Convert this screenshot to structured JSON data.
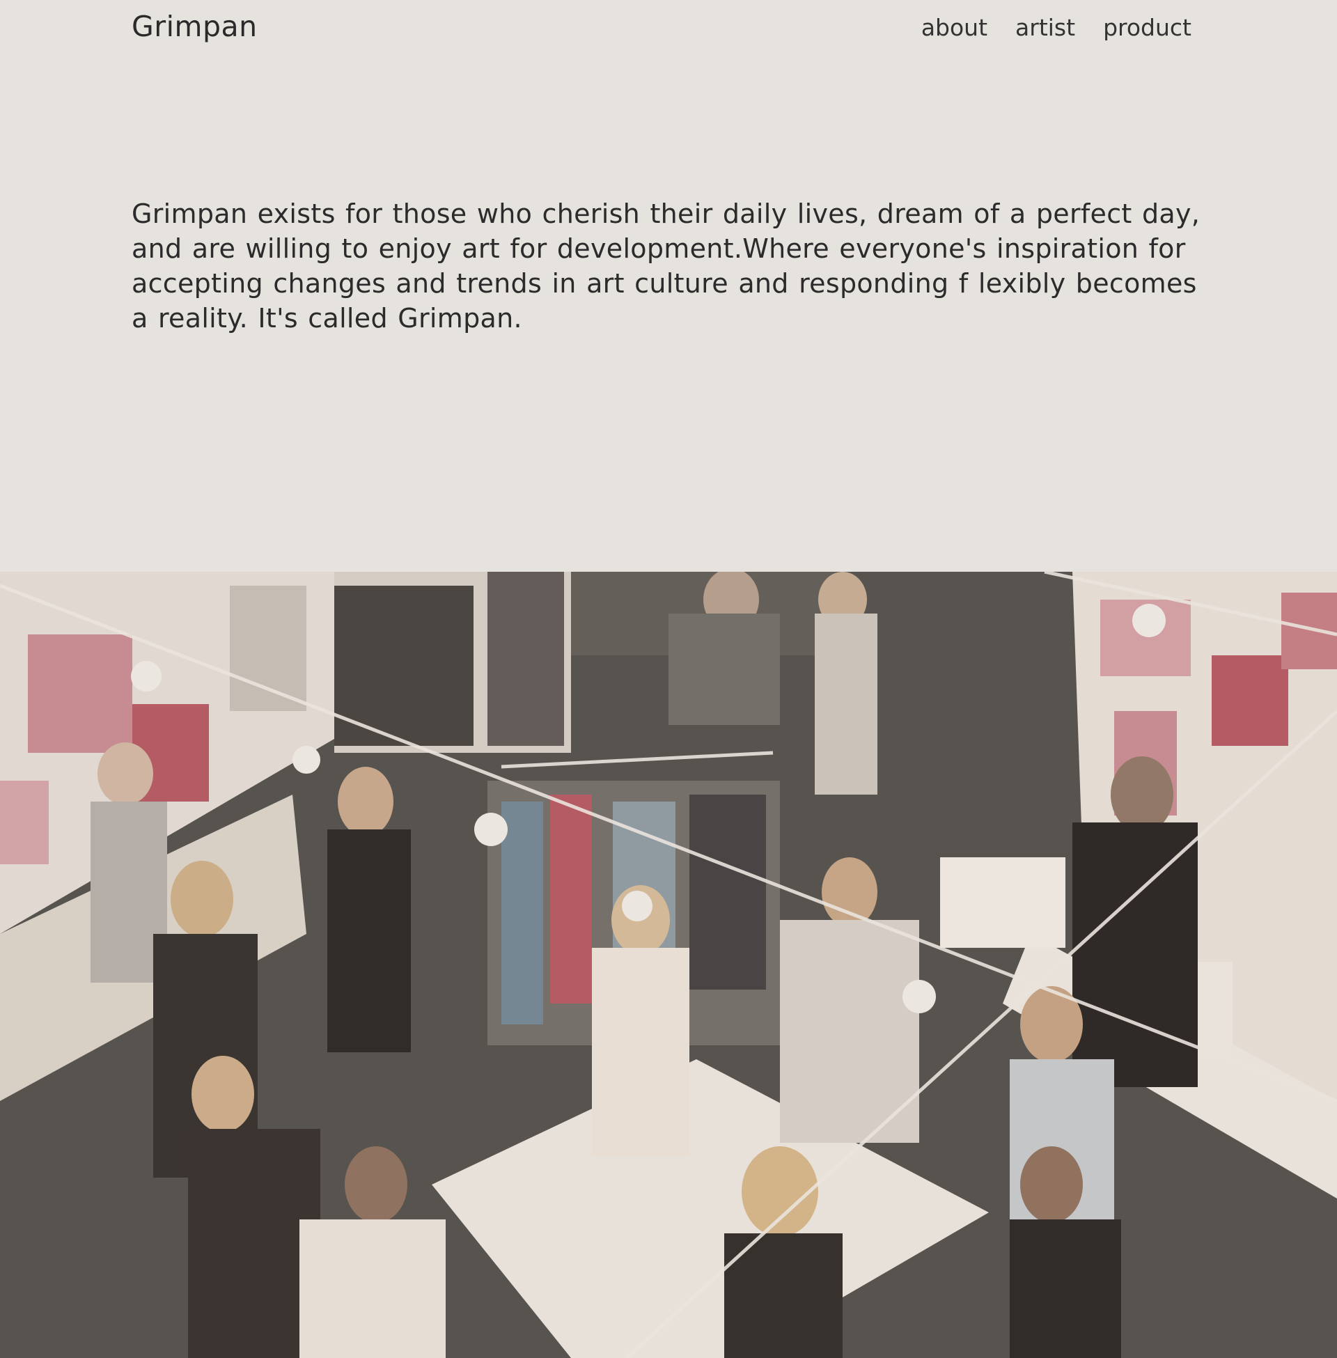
{
  "header": {
    "logo": "Grimpan",
    "nav": [
      {
        "label": "about"
      },
      {
        "label": "artist"
      },
      {
        "label": "product"
      }
    ]
  },
  "intro": {
    "text": "Grimpan exists for those who cherish their daily lives, dream of a perfect day, and are willing to enjoy art for development.Where everyone's inspiration for accepting changes and trends in art culture and responding f lexibly becomes a reality. It's called Grimpan."
  },
  "hero": {
    "image": "art-fair-crowd-photo",
    "colors": {
      "floor": "#4a4846",
      "wall": "#e9e4df",
      "accent_pink": "#c98a93",
      "accent_red": "#b5535f"
    }
  }
}
